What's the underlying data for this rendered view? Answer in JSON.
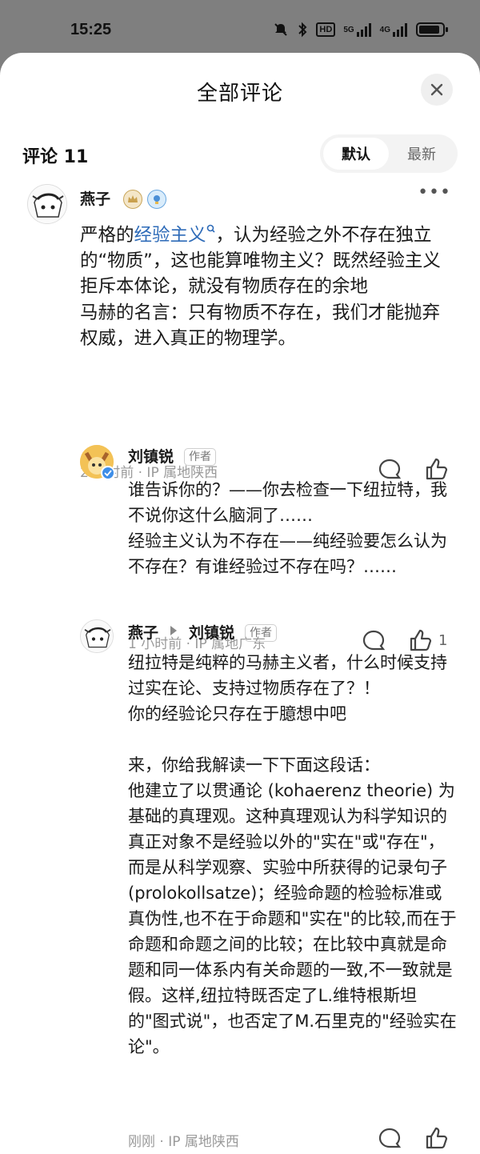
{
  "status_bar": {
    "time": "15:25",
    "network_labels": [
      "HD",
      "5G",
      "4G"
    ]
  },
  "sheet": {
    "title": "全部评论",
    "comment_count": "评论 11",
    "sort_options": [
      "默认",
      "最新"
    ],
    "active_sort": "默认"
  },
  "comments": [
    {
      "user": "燕子",
      "text_prefix": "严格的",
      "text_link": "经验主义",
      "text_rest": "，认为经验之外不存在独立的“物质”，这也能算唯物主义？既然经验主义拒斥本体论，就没有物质存在的余地\n马赫的名言：只有物质不存在，我们才能抛弃权威，进入真正的物理学。",
      "meta": "2 小时前 · IP 属地陕西",
      "likes": ""
    },
    {
      "user": "刘镇锐",
      "author_tag": "作者",
      "text": "谁告诉你的？——你去检查一下纽拉特，我不说你这什么脑洞了……\n经验主义认为不存在——纯经验要怎么认为不存在？有谁经验过不存在吗？……",
      "meta": "1 小时前 · IP 属地广东",
      "likes": "1"
    },
    {
      "user": "燕子",
      "reply_to": "刘镇锐",
      "author_tag": "作者",
      "text": "纽拉特是纯粹的马赫主义者，什么时候支持过实在论、支持过物质存在了？！\n你的经验论只存在于臆想中吧\n\n来，你给我解读一下下面这段话：\n他建立了以贯通论 (kohaerenz theorie) 为基础的真理观。这种真理观认为科学知识的真正对象不是经验以外的\"实在\"或\"存在\"，而是从科学观察、实验中所获得的记录句子 (prolokollsatze)；经验命题的检验标准或真伪性,也不在于命题和\"实在\"的比较,而在于命题和命题之间的比较；在比较中真就是命题和同一体系内有关命题的一致,不一致就是假。这样,纽拉特既否定了L.维特根斯坦的\"图式说\"，也否定了M.石里克的\"经验实在论\"。",
      "meta": "刚刚 · IP 属地陕西",
      "likes": ""
    }
  ]
}
